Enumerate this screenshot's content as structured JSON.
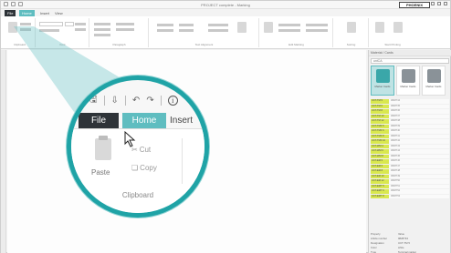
{
  "window": {
    "title": "PROJECT complete - Marking"
  },
  "brand": {
    "logo_text": "PHOENIX"
  },
  "tabs": [
    {
      "label": "File"
    },
    {
      "label": "Home"
    },
    {
      "label": "Insert"
    },
    {
      "label": "View"
    }
  ],
  "ribbon_groups": [
    {
      "label": "Clipboard"
    },
    {
      "label": "Font"
    },
    {
      "label": "Paragraph"
    },
    {
      "label": "Text Alignment"
    },
    {
      "label": "Edit Marking"
    },
    {
      "label": "Sorting"
    },
    {
      "label": "Start Printing"
    }
  ],
  "magnifier": {
    "tabs": {
      "file": "File",
      "home": "Home",
      "insert": "Insert"
    },
    "paste_label": "Paste",
    "cut_label": "Cut",
    "copy_label": "Copy",
    "group_label": "Clipboard",
    "info_glyph": "i"
  },
  "right_panel": {
    "title": "Material / Cards",
    "search_value": "uniCA",
    "thumbs": [
      {
        "label": "Marker Cards",
        "selected": true
      },
      {
        "label": "Marker Cards"
      },
      {
        "label": "Marker Cards"
      }
    ],
    "rows": [
      {
        "key": "UCT-TM 5",
        "value": "0828734"
      },
      {
        "key": "UCT-TM 6",
        "value": "0828735"
      },
      {
        "key": "UCT-TM 8",
        "value": "0828736"
      },
      {
        "key": "UCT-TM 10",
        "value": "0828737"
      },
      {
        "key": "UCT-TM 12",
        "value": "0828738"
      },
      {
        "key": "UCT-TMF 5",
        "value": "0828739"
      },
      {
        "key": "UCT-TMF 6",
        "value": "0828740"
      },
      {
        "key": "UCT-TMF 8",
        "value": "0828741"
      },
      {
        "key": "UCT-TMF 10",
        "value": "0828742"
      },
      {
        "key": "UCT-WM 4",
        "value": "0828743"
      },
      {
        "key": "UCT-WM 6",
        "value": "0828744"
      },
      {
        "key": "UCT-WM 8",
        "value": "0828745"
      },
      {
        "key": "UCT-EM 5",
        "value": "0828746"
      },
      {
        "key": "UCT-EM 6",
        "value": "0828747"
      },
      {
        "key": "UCT-EM 8",
        "value": "0828748"
      },
      {
        "key": "UCT-EM 10",
        "value": "0828749"
      },
      {
        "key": "UCT-EM 12",
        "value": "0828750"
      },
      {
        "key": "UCT-EMT 5",
        "value": "0828751"
      },
      {
        "key": "UCT-EMT 6",
        "value": "0828752"
      },
      {
        "key": "UCT-EMT 8",
        "value": "0828753"
      }
    ],
    "props": [
      {
        "key": "Property",
        "value": "Value"
      },
      {
        "key": "Article number",
        "value": "0828734"
      },
      {
        "key": "Designation",
        "value": "UCT-TM 5"
      },
      {
        "key": "Color",
        "value": "white"
      },
      {
        "key": "Type",
        "value": "Terminal marker"
      }
    ]
  }
}
